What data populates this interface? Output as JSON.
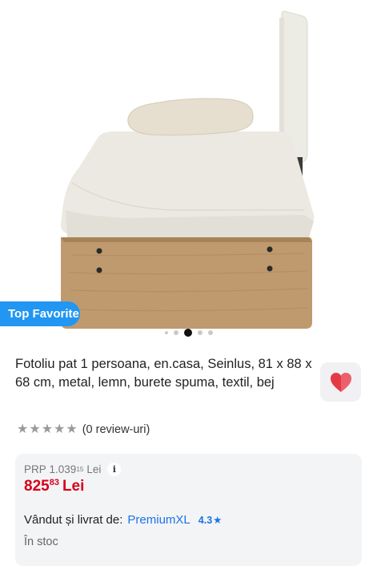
{
  "gallery": {
    "badge": "Top Favorite",
    "slide_count": 5,
    "active_slide": 3
  },
  "product": {
    "title": "Fotoliu pat 1 persoana, en.casa, Seinlus, 81 x 88 x 68 cm, metal, lemn, burete spuma, textil, bej",
    "rating": {
      "stars_filled": 0,
      "stars_total": 5,
      "reviews_label": "(0 review-uri)"
    },
    "favorite_icon": "heart-icon"
  },
  "pricing": {
    "prp_label": "PRP",
    "prp_int": "1.039",
    "prp_dec": "15",
    "prp_currency": "Lei",
    "info_symbol": "i",
    "price_int": "825",
    "price_dec": "83",
    "price_currency": "Lei",
    "seller_label": "Vândut și livrat de:",
    "seller_name": "PremiumXL",
    "seller_rating": "4.3",
    "seller_star": "★",
    "stock": "În stoc"
  },
  "colors": {
    "badge": "#2196f3",
    "price": "#d6001c",
    "link": "#1a73e8",
    "heart": "#e53945"
  }
}
